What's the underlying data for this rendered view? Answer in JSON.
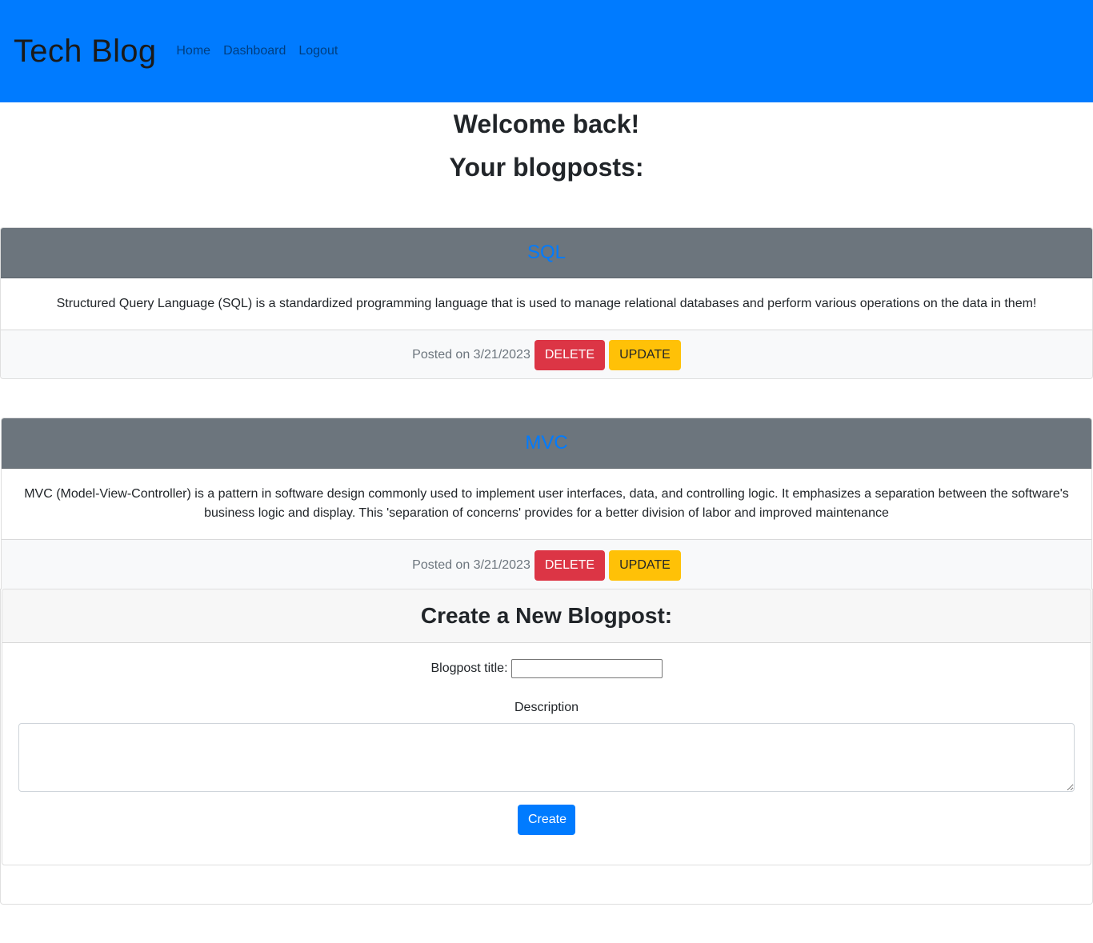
{
  "navbar": {
    "brand": "Tech Blog",
    "links": [
      "Home",
      "Dashboard",
      "Logout"
    ]
  },
  "welcome": "Welcome back!",
  "posts_heading": "Your blogposts:",
  "posts": [
    {
      "title": "SQL",
      "body": "Structured Query Language (SQL) is a standardized programming language that is used to manage relational databases and perform various operations on the data in them!",
      "posted": "Posted on 3/21/2023",
      "delete_label": "DELETE",
      "update_label": "UPDATE"
    },
    {
      "title": "MVC",
      "body": "MVC (Model-View-Controller) is a pattern in software design commonly used to implement user interfaces, data, and controlling logic. It emphasizes a separation between the software's business logic and display. This 'separation of concerns' provides for a better division of labor and improved maintenance",
      "posted": "Posted on 3/21/2023",
      "delete_label": "DELETE",
      "update_label": "UPDATE"
    }
  ],
  "create": {
    "heading": "Create a New Blogpost:",
    "title_label": "Blogpost title:",
    "title_value": "",
    "description_label": "Description",
    "description_value": "",
    "button_label": "Create"
  },
  "colors": {
    "navbar": "#007bff",
    "post_header": "#6c757d",
    "danger": "#dc3545",
    "warning": "#ffc107",
    "primary": "#007bff"
  }
}
